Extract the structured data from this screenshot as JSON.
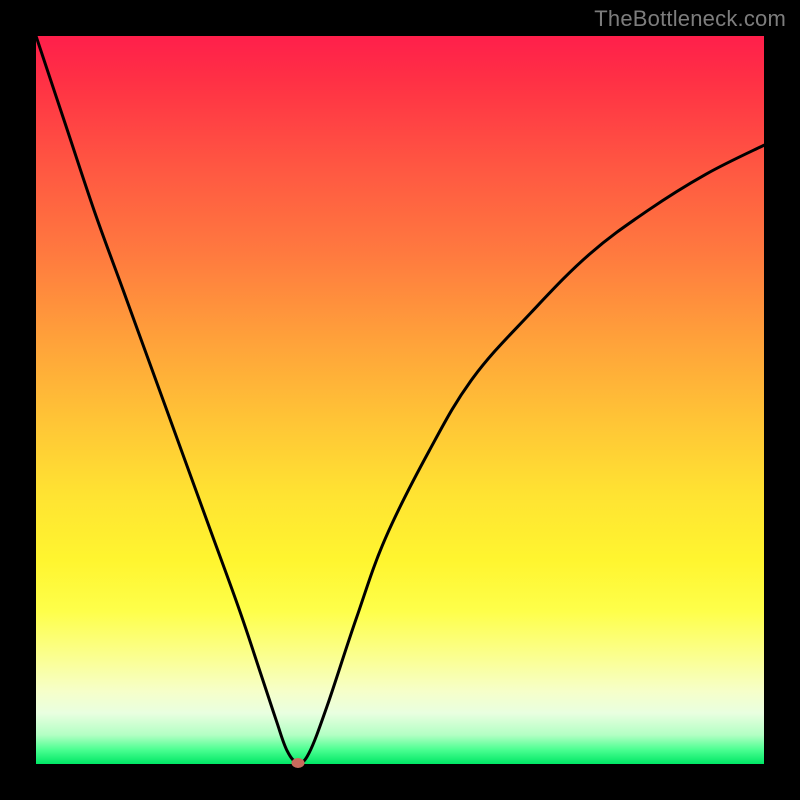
{
  "watermark": "TheBottleneck.com",
  "colors": {
    "marker": "#c96a5c",
    "curve": "#000000"
  },
  "chart_data": {
    "type": "line",
    "title": "",
    "xlabel": "",
    "ylabel": "",
    "xlim": [
      0,
      100
    ],
    "ylim": [
      0,
      100
    ],
    "grid": false,
    "legend": false,
    "note": "V-shaped bottleneck curve. Minimum (optimum / green zone) near x≈36, y≈0. Values estimated from pixel positions; no axis ticks shown.",
    "series": [
      {
        "name": "bottleneck-curve",
        "x": [
          0,
          4,
          8,
          12,
          16,
          20,
          24,
          28,
          31,
          33,
          34.5,
          36,
          37.5,
          40,
          44,
          48,
          54,
          60,
          68,
          76,
          84,
          92,
          100
        ],
        "y": [
          100,
          88,
          76,
          65,
          54,
          43,
          32,
          21,
          12,
          6,
          1.8,
          0.2,
          1.5,
          8,
          20,
          31,
          43,
          53,
          62,
          70,
          76,
          81,
          85
        ]
      }
    ],
    "marker": {
      "x": 36,
      "y": 0.2
    },
    "gradient_zones": [
      {
        "label": "severe-bottleneck",
        "color": "#ff1f4b",
        "y": 100
      },
      {
        "label": "moderate",
        "color": "#ffe332",
        "y": 40
      },
      {
        "label": "optimal",
        "color": "#00e765",
        "y": 0
      }
    ]
  }
}
